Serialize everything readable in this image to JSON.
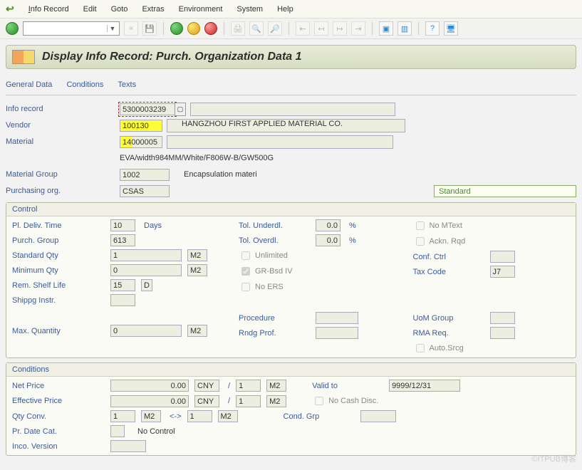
{
  "menu": {
    "info_record": "Info Record",
    "edit": "Edit",
    "goto": "Goto",
    "extras": "Extras",
    "environment": "Environment",
    "system": "System",
    "help": "Help"
  },
  "title": "Display Info Record: Purch. Organization Data 1",
  "tabs": {
    "general": "General Data",
    "conditions": "Conditions",
    "texts": "Texts"
  },
  "header": {
    "info_record_label": "Info record",
    "info_record_value": "5300003239",
    "vendor_label": "Vendor",
    "vendor_value": "100130",
    "vendor_name": "HANGZHOU FIRST APPLIED MATERIAL CO.",
    "material_label": "Material",
    "material_value": "14000005",
    "material_desc": "EVA/width984MM/White/F806W-B/GW500G",
    "mat_group_label": "Material Group",
    "mat_group_value": "1002",
    "mat_group_desc": "Encapsulation materi",
    "porg_label": "Purchasing org.",
    "porg_value": "CSAS",
    "status": "Standard"
  },
  "control": {
    "title": "Control",
    "pl_deliv_label": "Pl. Deliv. Time",
    "pl_deliv_value": "10",
    "days": "Days",
    "purch_group_label": "Purch. Group",
    "purch_group_value": "613",
    "std_qty_label": "Standard Qty",
    "std_qty_value": "1",
    "std_qty_uom": "M2",
    "min_qty_label": "Minimum Qty",
    "min_qty_value": "0",
    "min_qty_uom": "M2",
    "rem_shelf_label": "Rem. Shelf Life",
    "rem_shelf_value": "15",
    "rem_shelf_unit": "D",
    "shippg_label": "Shippg Instr.",
    "max_qty_label": "Max. Quantity",
    "max_qty_value": "0",
    "max_qty_uom": "M2",
    "tol_under_label": "Tol. Underdl.",
    "tol_under_value": "0.0",
    "tol_over_label": "Tol. Overdl.",
    "tol_over_value": "0.0",
    "pct": "%",
    "unlimited": "Unlimited",
    "grbsd": "GR-Bsd IV",
    "noers": "No ERS",
    "procedure_label": "Procedure",
    "rndg_label": "Rndg Prof.",
    "no_mtext": "No MText",
    "ackn_rqd": "Ackn. Rqd",
    "conf_ctrl_label": "Conf. Ctrl",
    "tax_code_label": "Tax Code",
    "tax_code_value": "J7",
    "uom_group_label": "UoM Group",
    "rma_label": "RMA Req.",
    "auto_srcg": "Auto.Srcg"
  },
  "conditions": {
    "title": "Conditions",
    "net_price_label": "Net Price",
    "net_price_value": "0.00",
    "currency": "CNY",
    "slash": "/",
    "per_value": "1",
    "per_uom": "M2",
    "eff_price_label": "Effective Price",
    "eff_price_value": "0.00",
    "valid_to_label": "Valid to",
    "valid_to_value": "9999/12/31",
    "no_cash_disc": "No Cash Disc.",
    "qty_conv_label": "Qty Conv.",
    "qty_conv_v1": "1",
    "qty_conv_u1": "M2",
    "arrow": "<->",
    "qty_conv_v2": "1",
    "qty_conv_u2": "M2",
    "cond_grp_label": "Cond. Grp",
    "pr_date_label": "Pr. Date Cat.",
    "pr_date_value": "No Control",
    "inco_label": "Inco. Version"
  },
  "watermark": "©ITPUB博客"
}
